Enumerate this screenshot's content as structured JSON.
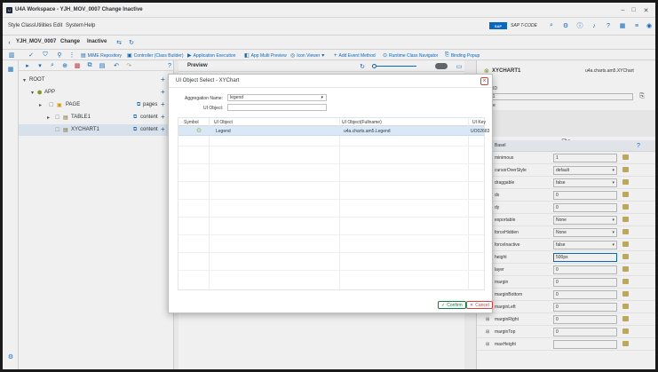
{
  "window": {
    "title": "U4A Workspace - YJH_MOV_0007 Change Inactive"
  },
  "menu": {
    "items": [
      "Style Class",
      "Utilities",
      "Edit",
      "System",
      "Help"
    ],
    "sap_label": "SAP T-CODE"
  },
  "nav": {
    "app_id": "YJH_MOV_0007",
    "mode": "Change",
    "status": "Inactive"
  },
  "toolbar": {
    "items": [
      "MIME Repository",
      "Controller (Class Builder)",
      "Application Execution",
      "App Multi Preview",
      "Icon Viewer",
      "Add Event Method",
      "Runtime Class Navigator",
      "Binding Popup"
    ]
  },
  "tree": {
    "rows": [
      {
        "label": "ROOT",
        "prop": ""
      },
      {
        "label": "APP",
        "prop": ""
      },
      {
        "label": "PAGE",
        "prop": "pages"
      },
      {
        "label": "TABLE1",
        "prop": "content"
      },
      {
        "label": "XYCHART1",
        "prop": "content"
      }
    ]
  },
  "preview": {
    "title": "Preview"
  },
  "props": {
    "title": "XYCHART1",
    "class_name": "u4a.charts.am5.XYChart",
    "object_id_label": "ect ID",
    "object_id_value": "RT1",
    "section_label": "ibute",
    "tab_label": "Basel",
    "rows": [
      {
        "name": "minimous",
        "value": "1",
        "kind": "text"
      },
      {
        "name": "cursorOverStyle",
        "value": "default",
        "kind": "select"
      },
      {
        "name": "draggable",
        "value": "false",
        "kind": "select"
      },
      {
        "name": "dx",
        "value": "0",
        "kind": "text"
      },
      {
        "name": "dy",
        "value": "0",
        "kind": "text"
      },
      {
        "name": "exportable",
        "value": "None",
        "kind": "select"
      },
      {
        "name": "forceHidden",
        "value": "None",
        "kind": "select"
      },
      {
        "name": "forceInactive",
        "value": "false",
        "kind": "select"
      },
      {
        "name": "height",
        "value": "500px",
        "kind": "focus"
      },
      {
        "name": "layer",
        "value": "0",
        "kind": "text"
      },
      {
        "name": "margin",
        "value": "0",
        "kind": "text"
      },
      {
        "name": "marginBottom",
        "value": "0",
        "kind": "text"
      },
      {
        "name": "marginLeft",
        "value": "0",
        "kind": "text"
      },
      {
        "name": "marginRight",
        "value": "0",
        "kind": "text"
      },
      {
        "name": "marginTop",
        "value": "0",
        "kind": "text"
      },
      {
        "name": "maxHeight",
        "value": "",
        "kind": "text"
      }
    ]
  },
  "dialog": {
    "title": "UI Object Select - XYChart",
    "aggregation_label": "Aggregation Name:",
    "aggregation_value": "legend",
    "ui_object_label": "UI Object:",
    "columns": [
      "Symbol",
      "UI Object",
      "UI Object(Fullname)",
      "UI Key"
    ],
    "row": {
      "object": "Legend",
      "fullname": "u4a.charts.am5.Legend",
      "key": "UO02683"
    },
    "confirm_label": "Confirm",
    "cancel_label": "Cancel"
  }
}
